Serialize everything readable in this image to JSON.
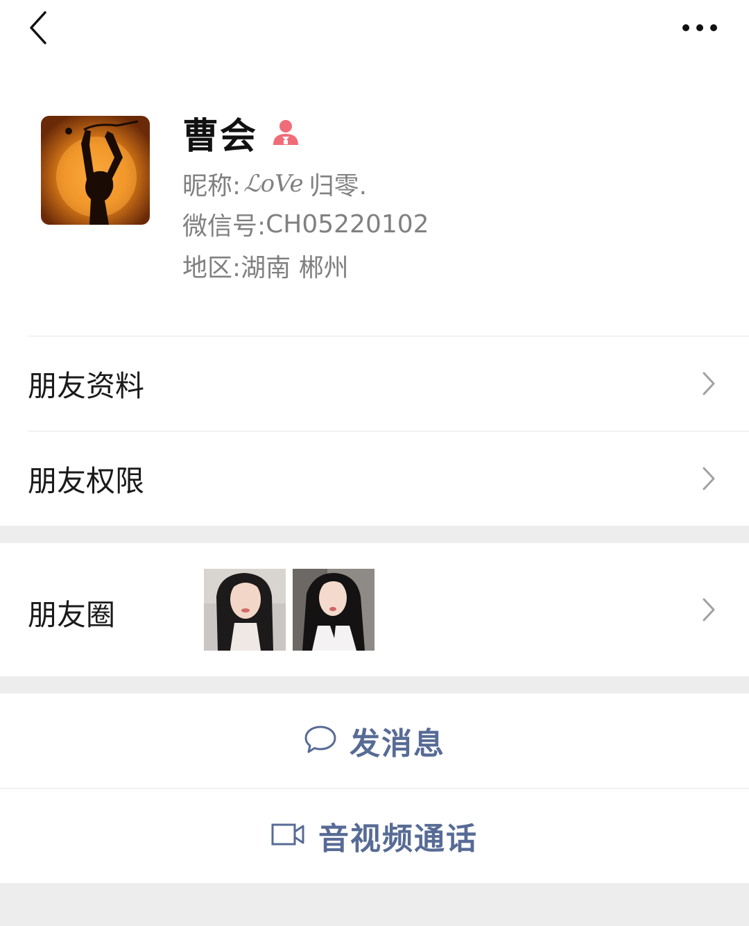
{
  "nav": {
    "back_icon": "chevron-left-icon",
    "more_icon": "more-dots-icon"
  },
  "profile": {
    "name": "曹会",
    "gender_icon": "female-icon",
    "gender_color": "#f06c78",
    "nickname_label": "昵称:",
    "nickname_script": "ℒoVe",
    "nickname_rest": "归零.",
    "wechat_id_label": "微信号:",
    "wechat_id": "CH05220102",
    "region_label": "地区:",
    "region": "湖南 郴州"
  },
  "menu": {
    "friend_info": "朋友资料",
    "friend_permissions": "朋友权限",
    "moments": "朋友圈"
  },
  "actions": {
    "send_message": "发消息",
    "video_call": "音视频通话"
  },
  "colors": {
    "link_blue": "#576b95",
    "text_gray": "#808080",
    "background": "#ededed"
  }
}
